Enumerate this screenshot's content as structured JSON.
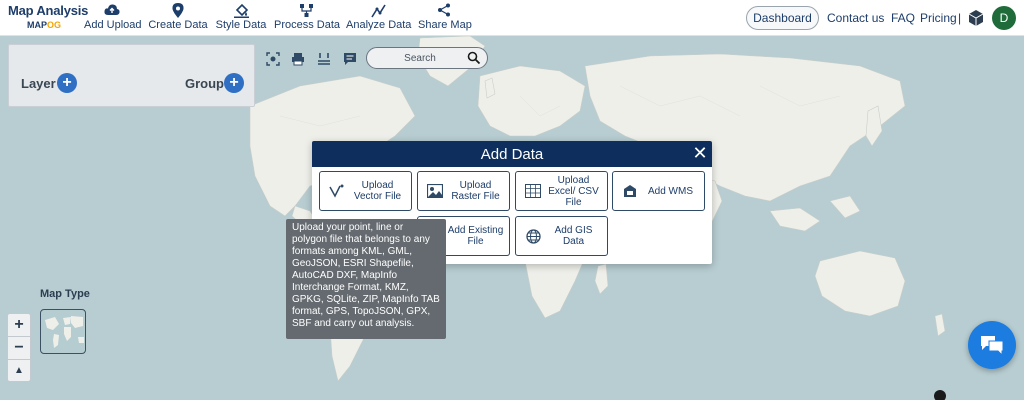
{
  "app": {
    "logo_title": "Map Analysis",
    "logo_sub_a": "MAP",
    "logo_sub_b": "OG"
  },
  "nav": {
    "items": [
      {
        "label": "Add Upload",
        "icon": "cloud-upload-icon"
      },
      {
        "label": "Create Data",
        "icon": "map-pin-icon"
      },
      {
        "label": "Style Data",
        "icon": "paint-bucket-icon"
      },
      {
        "label": "Process Data",
        "icon": "process-nodes-icon"
      },
      {
        "label": "Analyze Data",
        "icon": "analyze-icon"
      },
      {
        "label": "Share Map",
        "icon": "share-icon"
      }
    ],
    "dashboard": "Dashboard",
    "contact": "Contact us",
    "faq": "FAQ",
    "pricing": "Pricing",
    "pricing_sep": "|",
    "user_initial": "D"
  },
  "layer_panel": {
    "layer_label": "Layer",
    "group_label": "Group"
  },
  "search": {
    "placeholder": "Search"
  },
  "modal": {
    "title": "Add Data",
    "options": [
      {
        "label": "Upload Vector File",
        "icon": "vector-icon"
      },
      {
        "label": "Upload Raster File",
        "icon": "raster-image-icon"
      },
      {
        "label": "Upload Excel/ CSV File",
        "icon": "spreadsheet-icon"
      },
      {
        "label": "Add WMS",
        "icon": "wms-layers-icon"
      },
      {
        "label": "Add Existing File",
        "icon": "folder-icon"
      },
      {
        "label": "Add GIS Data",
        "icon": "globe-icon"
      }
    ]
  },
  "tooltip": {
    "text": "Upload your point, line or polygon file that belongs to any formats among KML, GML, GeoJSON, ESRI Shapefile, AutoCAD DXF, MapInfo Interchange Format, KMZ, GPKG, SQLite, ZIP, MapInfo TAB format, GPS, TopoJSON, GPX, SBF and carry out analysis."
  },
  "map": {
    "map_type_label": "Map Type",
    "zoom_in": "+",
    "zoom_out": "−",
    "reset_north": "▲"
  },
  "colors": {
    "accent": "#0e2f5d",
    "button_blue": "#2f6fc4",
    "chat_blue": "#1c7ce0",
    "avatar_green": "#1f6b3a",
    "water": "#b7cdd1",
    "land": "#efefea"
  }
}
